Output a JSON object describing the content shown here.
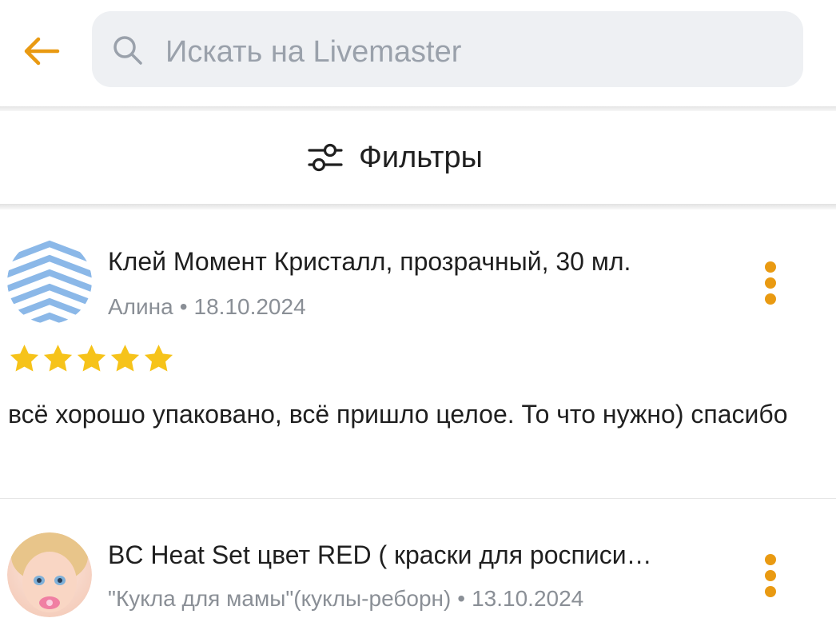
{
  "search": {
    "placeholder": "Искать на Livemaster",
    "value": ""
  },
  "filters": {
    "label": "Фильтры"
  },
  "colors": {
    "accent": "#e99a12",
    "star": "#f6c31a",
    "search_bg": "#eef0f3"
  },
  "reviews": [
    {
      "product": "Клей Момент Кристалл, прозрачный, 30 мл.",
      "author": "Алина",
      "date": "18.10.2024",
      "rating": 5,
      "rating_max": 5,
      "text": "всё хорошо упаковано, всё пришло целое. То что нужно) спасибо",
      "avatar": "striped-logo-avatar"
    },
    {
      "product": "BC Heat Set цвет RED  ( краски для росписи…",
      "author": "\"Кукла для мамы\"(куклы-реборн)",
      "date": "13.10.2024",
      "avatar": "doll-photo-avatar"
    }
  ]
}
